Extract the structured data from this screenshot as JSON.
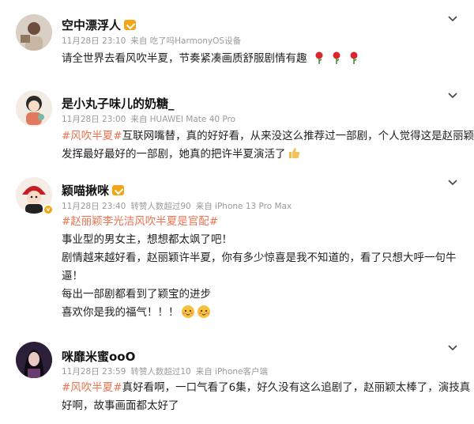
{
  "comments": [
    {
      "user": "空中漂浮人",
      "date": "11月28日 23:10",
      "source": "来自 吃了吗HarmonyOS设备",
      "likes_text": "",
      "lines": [
        [
          {
            "t": "请全世界去看风吹半夏，节奏紧凑画质舒服剧情有趣"
          }
        ]
      ]
    },
    {
      "user": "是小丸子味儿的奶糖_",
      "date": "11月28日 23:00",
      "source": "来自 HUAWEI Mate 40 Pro",
      "likes_text": "",
      "lines": [
        [
          {
            "t": "#风吹半夏#",
            "tag": true
          },
          {
            "t": "互联网嘴替，真的好好看，从来没这么推荐过一部剧，个人觉得这是赵丽颖"
          }
        ],
        [
          {
            "t": "发挥最好最好的一部剧，她真的把许半夏演活了"
          }
        ]
      ]
    },
    {
      "user": "颖喵揪咪",
      "date": "11月28日 23:40",
      "source": "来自 iPhone 13 Pro Max",
      "likes_text": "转赞人数超过90",
      "lines": [
        [
          {
            "t": "#赵丽颖李光洁风吹半夏是官配#",
            "tag": true
          }
        ],
        [
          {
            "t": "事业型的男女主，想想都太飒了吧！"
          }
        ],
        [
          {
            "t": "剧情越来越好看，赵丽颖许半夏，你有多少惊喜是我不知道的，看了只想大呼一句牛"
          }
        ],
        [
          {
            "t": "逼！"
          }
        ],
        [
          {
            "t": "每出一部剧都看到了颖宝的进步"
          }
        ],
        [
          {
            "t": "喜欢你是我的福气！！！"
          }
        ]
      ]
    },
    {
      "user": "咪靡米蜜ooO",
      "date": "11月28日 23:59",
      "source": "来自 iPhone客户端",
      "likes_text": "转赞人数超过10",
      "lines": [
        [
          {
            "t": "#风吹半夏#",
            "tag": true
          },
          {
            "t": "真好看啊，一口气看了6集，好久没有这么追剧了，赵丽颖太棒了，演技真"
          }
        ],
        [
          {
            "t": "好啊，故事画面都太好了"
          }
        ]
      ]
    }
  ],
  "colors": {
    "tag": "#eb7350",
    "meta": "#9a9a9a",
    "member": "#f2a516"
  },
  "icons": [
    "chevron-down-icon",
    "member-badge-icon",
    "rose-emoji-icon",
    "thumbs-up-emoji-icon",
    "blush-face-emoji-icon",
    "verified-badge-icon"
  ]
}
